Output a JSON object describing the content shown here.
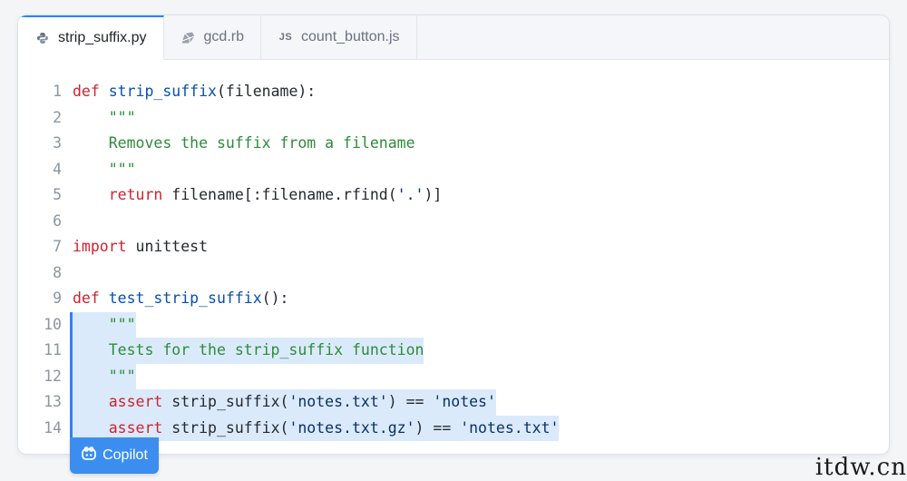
{
  "tabs": [
    {
      "label": "strip_suffix.py",
      "icon": "python-icon",
      "active": true
    },
    {
      "label": "gcd.rb",
      "icon": "ruby-icon",
      "active": false
    },
    {
      "label": "count_button.js",
      "icon": "js-icon",
      "icon_text": "JS",
      "active": false
    }
  ],
  "code": {
    "lines": [
      {
        "n": "1",
        "hl": false,
        "tokens": [
          {
            "t": "def",
            "c": "kw"
          },
          {
            "t": " "
          },
          {
            "t": "strip_suffix",
            "c": "fn"
          },
          {
            "t": "(filename):"
          }
        ]
      },
      {
        "n": "2",
        "hl": false,
        "tokens": [
          {
            "t": "    "
          },
          {
            "t": "\"\"\"",
            "c": "doc"
          }
        ]
      },
      {
        "n": "3",
        "hl": false,
        "tokens": [
          {
            "t": "    "
          },
          {
            "t": "Removes the suffix from a filename",
            "c": "doc"
          }
        ]
      },
      {
        "n": "4",
        "hl": false,
        "tokens": [
          {
            "t": "    "
          },
          {
            "t": "\"\"\"",
            "c": "doc"
          }
        ]
      },
      {
        "n": "5",
        "hl": false,
        "tokens": [
          {
            "t": "    "
          },
          {
            "t": "return",
            "c": "kw"
          },
          {
            "t": " filename[:filename.rfind("
          },
          {
            "t": "'.'",
            "c": "str"
          },
          {
            "t": ")]"
          }
        ]
      },
      {
        "n": "6",
        "hl": false,
        "tokens": []
      },
      {
        "n": "7",
        "hl": false,
        "tokens": [
          {
            "t": "import",
            "c": "kw"
          },
          {
            "t": " unittest"
          }
        ]
      },
      {
        "n": "8",
        "hl": false,
        "tokens": []
      },
      {
        "n": "9",
        "hl": false,
        "tokens": [
          {
            "t": "def",
            "c": "kw"
          },
          {
            "t": " "
          },
          {
            "t": "test_strip_suffix",
            "c": "fn"
          },
          {
            "t": "():"
          }
        ]
      },
      {
        "n": "10",
        "hl": true,
        "tokens": [
          {
            "t": "    "
          },
          {
            "t": "\"\"\"",
            "c": "doc"
          }
        ]
      },
      {
        "n": "11",
        "hl": true,
        "tokens": [
          {
            "t": "    "
          },
          {
            "t": "Tests for the strip_suffix function",
            "c": "doc"
          }
        ]
      },
      {
        "n": "12",
        "hl": true,
        "tokens": [
          {
            "t": "    "
          },
          {
            "t": "\"\"\"",
            "c": "doc"
          }
        ]
      },
      {
        "n": "13",
        "hl": true,
        "tokens": [
          {
            "t": "    "
          },
          {
            "t": "assert",
            "c": "kw"
          },
          {
            "t": " strip_suffix("
          },
          {
            "t": "'notes.txt'",
            "c": "str"
          },
          {
            "t": ") == "
          },
          {
            "t": "'notes'",
            "c": "str"
          }
        ]
      },
      {
        "n": "14",
        "hl": true,
        "tokens": [
          {
            "t": "    "
          },
          {
            "t": "assert",
            "c": "kw"
          },
          {
            "t": " strip_suffix("
          },
          {
            "t": "'notes.txt.gz'",
            "c": "str"
          },
          {
            "t": ") == "
          },
          {
            "t": "'notes.txt'",
            "c": "str"
          }
        ]
      }
    ]
  },
  "copilot": {
    "label": "Copilot",
    "icon": "copilot-icon"
  },
  "watermark": "itdw.cn",
  "colors": {
    "accent": "#2f81f7",
    "highlight": "#dbeafb",
    "keyword": "#cf222e",
    "function": "#0550ae",
    "string": "#0a3069",
    "docstring": "#2e8b3a"
  }
}
